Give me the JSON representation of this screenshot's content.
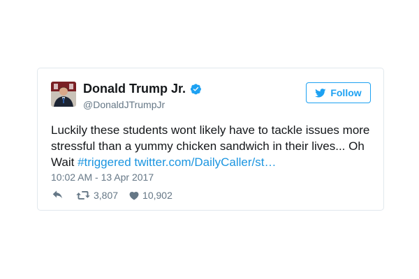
{
  "tweet": {
    "author": {
      "display_name": "Donald Trump Jr.",
      "handle": "@DonaldJTrumpJr",
      "verified": true,
      "avatar_icon": "profile-photo"
    },
    "follow_label": "Follow",
    "text_plain": "Luckily these students wont likely have to tackle issues more stressful than a yummy chicken sandwich in their lives... Oh Wait ",
    "hashtag": "#triggered",
    "link": "twitter.com/DailyCaller/st…",
    "timestamp": "10:02 AM - 13 Apr 2017",
    "retweet_count": "3,807",
    "like_count": "10,902"
  },
  "colors": {
    "accent": "#1da1f2",
    "link": "#1b95e0",
    "text": "#14171a",
    "muted": "#657786",
    "border": "#e1e8ed"
  },
  "icons": {
    "reply": "reply-icon",
    "retweet": "retweet-icon",
    "like": "heart-icon",
    "verified": "verified-badge-icon",
    "follow": "twitter-bird-icon"
  }
}
